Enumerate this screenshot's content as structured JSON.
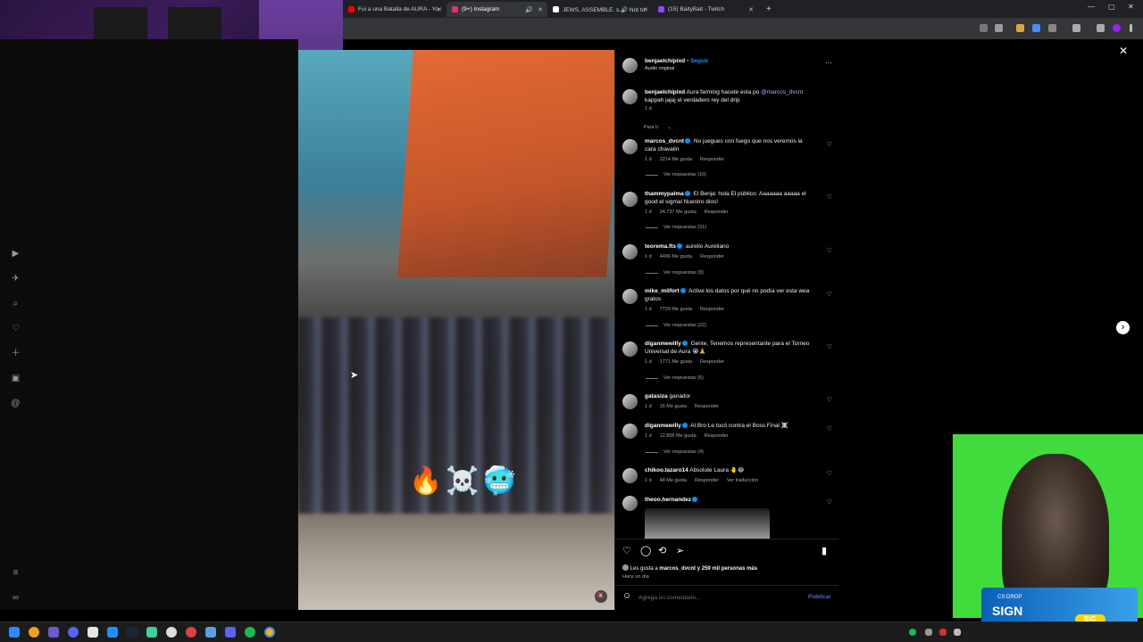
{
  "browser": {
    "tabs": [
      {
        "title": "Fui a una Batalla de AURA - Yo",
        "favicon_color": "#ff0000"
      },
      {
        "title": "(9+) Instagram",
        "favicon_color": "#e1306c"
      },
      {
        "title": "JEWS, ASSEMBLE. s.🔊 Not to",
        "favicon_color": "#ffffff"
      },
      {
        "title": "(15) BaityBait - Twitch",
        "favicon_color": "#9146ff"
      }
    ],
    "new_tab": "+",
    "window_controls": {
      "minimize": "—",
      "maximize": "▢",
      "close": "✕"
    }
  },
  "post": {
    "author": "benjaelchipixd",
    "follow_label": "Seguir",
    "audio": "Audio original",
    "more": "···",
    "caption_user": "benjaelchipixd",
    "caption_text": "Aura farming hacete esta po",
    "caption_mention": "@marcos_dvcnt",
    "caption_text2": "kappah jajaj el verdadero rey del drip",
    "caption_time": "1 d",
    "for_you": "Para ti",
    "video_emojis": "🔥☠️🥶"
  },
  "comments": [
    {
      "user": "marcos_dvcnt",
      "verified": true,
      "text": "No juegues con fuego que nos veremos la cara chavalin",
      "time": "1 d",
      "likes": "3214 Me gusta",
      "reply": "Responder",
      "replies": "Ver respuestas (10)"
    },
    {
      "user": "thammypalma",
      "verified": true,
      "text": "El Benja: hola El público: Aaaaaaa aaaaa el good el sigmal Nuestro dios!",
      "time": "1 d",
      "likes": "34.737 Me gusta",
      "reply": "Responder",
      "replies": "Ver respuestas (31)"
    },
    {
      "user": "teorema.fts",
      "verified": true,
      "text": "aurelio Aureliano",
      "time": "1 d",
      "likes": "4496 Me gusta",
      "reply": "Responder",
      "replies": "Ver respuestas (9)"
    },
    {
      "user": "mike_milfort",
      "verified": true,
      "text": "Active los datos por qué no podía ver esta wea gratos",
      "time": "1 d",
      "likes": "7729 Me gusta",
      "reply": "Responder",
      "replies": "Ver respuestas (22)"
    },
    {
      "user": "diganmewilly",
      "verified": true,
      "text": "Gente, Tenemos representante para el Torneo Universal de Aura 😭🙏",
      "time": "1 d",
      "likes": "1771 Me gusta",
      "reply": "Responder",
      "replies": "Ver respuestas (5)"
    },
    {
      "user": "gatasiza",
      "verified": false,
      "text": "ganador",
      "time": "1 d",
      "likes": "16 Me gusta",
      "reply": "Responder",
      "replies": ""
    },
    {
      "user": "diganmewilly",
      "verified": true,
      "text": "Al Bro Le tocó contra el Boss Final ☠️",
      "time": "1 d",
      "likes": "12.858 Me gusta",
      "reply": "Responder",
      "replies": "Ver respuestas (4)"
    },
    {
      "user": "chikoo.lazaro14",
      "verified": false,
      "text": "Absolute Laura 🤚😂",
      "time": "1 d",
      "likes": "48 Me gusta",
      "reply": "Responder",
      "translate": "Ver traducción",
      "replies": ""
    },
    {
      "user": "theoo.hernandez",
      "verified": true,
      "text": "",
      "time": "",
      "likes": "",
      "reply": "",
      "replies": ""
    }
  ],
  "actions": {
    "like_icon": "heart-outline-icon",
    "comment_icon": "speech-bubble-icon",
    "share_icon": "repost-icon",
    "send_icon": "paper-plane-icon",
    "save_icon": "bookmark-icon",
    "likes_summary_prefix": "Les gusta a",
    "likes_summary_user": "marcos_dvcnt",
    "likes_summary_suffix": "y 259 mil personas más",
    "posted": "Hace un día",
    "comment_placeholder": "Agrega un comentario...",
    "publish": "Publicar"
  },
  "modal": {
    "close": "✕",
    "next": "›"
  },
  "ad": {
    "brand": "CS:DROP",
    "text": "SIGN",
    "button": "SIG"
  },
  "colors": {
    "accent_blue": "#0095f6",
    "link": "#a5b4fc",
    "bg": "#000000"
  }
}
